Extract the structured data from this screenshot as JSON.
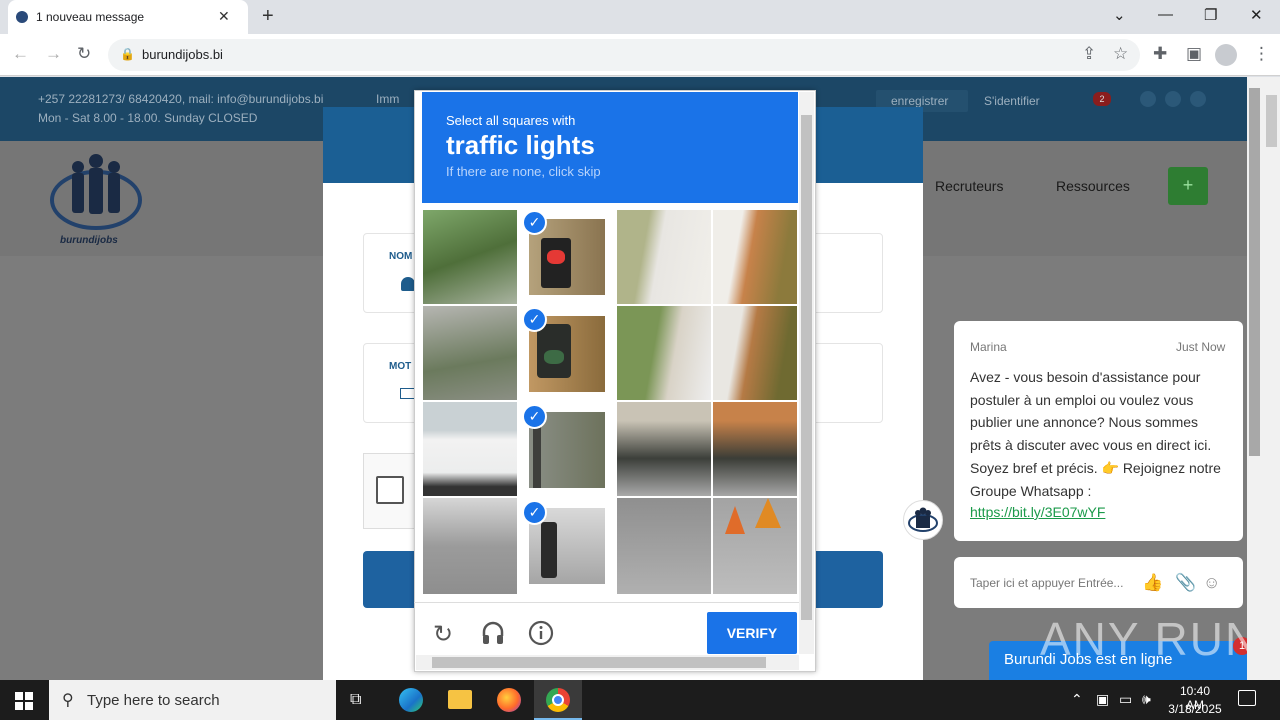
{
  "browser": {
    "tab_title": "1 nouveau message",
    "new_tab": "+",
    "url": "burundijobs.bi",
    "controls": {
      "minimize": "—",
      "restore": "❐",
      "close": "✕",
      "chevron": "⌄"
    }
  },
  "site": {
    "contact": "+257 22281273/ 68420420, mail: info@burundijobs.bi",
    "location_prefix": "Imm",
    "hours": "Mon - Sat 8.00 - 18.00. Sunday CLOSED",
    "register": "enregistrer",
    "login": "S'identifier",
    "notif_count": "2",
    "nav_recruiters": "Recruteurs",
    "nav_resources": "Ressources",
    "logo_text": "burundijobs",
    "field1_label": "NOM",
    "field2_label": "MOT"
  },
  "captcha": {
    "instruction": "Select all squares with",
    "target": "traffic lights",
    "hint": "If there are none, click skip",
    "verify": "VERIFY"
  },
  "chat": {
    "agent": "Marina",
    "time": "Just Now",
    "message": "Avez - vous besoin d'assistance pour postuler à un emploi ou voulez vous publier une annonce? Nous sommes prêts à discuter avec vous en direct ici. Soyez bref et précis. 👉 Rejoignez notre Groupe Whatsapp :",
    "link": "https://bit.ly/3E07wYF",
    "input_placeholder": "Taper ici et appuyer Entrée...",
    "online": "Burundi Jobs est en ligne",
    "badge": "1"
  },
  "watermark": "ANY RUN",
  "taskbar": {
    "search_placeholder": "Type here to search",
    "time": "10:40 AM",
    "date": "3/18/2025"
  }
}
